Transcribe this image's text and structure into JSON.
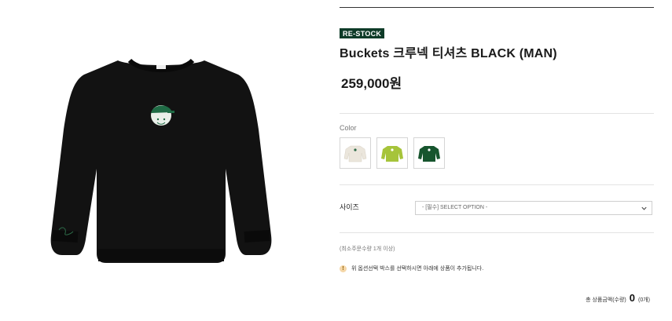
{
  "product": {
    "image_alt": "Black crewneck sweatshirt with green golf ball logo",
    "badge": "RE-STOCK",
    "title": "Buckets 크루넥 티셔츠 BLACK (MAN)",
    "price": "259,000원"
  },
  "color": {
    "label": "Color",
    "options": [
      {
        "name": "cream",
        "hex": "#ebe6dc"
      },
      {
        "name": "lime",
        "hex": "#a6c43a"
      },
      {
        "name": "green",
        "hex": "#17552e"
      }
    ]
  },
  "size": {
    "label": "사이즈",
    "select_value": "- [필수] SELECT OPTION -"
  },
  "min_order": "(최소주문수량 1개 이상)",
  "notice": {
    "icon": "!",
    "text": "위 옵션선택 박스를 선택하시면 아래에 상품이 추가됩니다."
  },
  "total": {
    "label": "총 상품금액(수량)",
    "amount": "0",
    "count": "(0개)"
  },
  "colors": {
    "badge_bg": "#0e3b28",
    "sweater": "#121212",
    "logo_green": "#1f6b45"
  }
}
